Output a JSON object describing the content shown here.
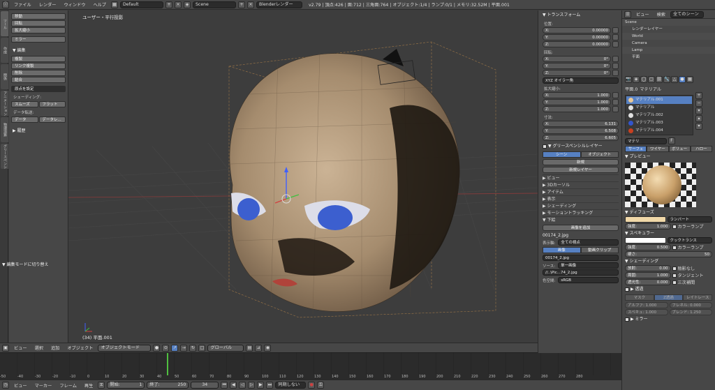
{
  "topbar": {
    "menus": [
      "ファイル",
      "レンダー",
      "ウィンドウ",
      "ヘルプ"
    ],
    "layout": "Default",
    "scene": "Scene",
    "engine": "Blenderレンダー",
    "stats": "v2.79 | 頂点:426 | 面:712 | 三角面:764 | オブジェクト:1/4 | ランプ:0/1 | メモリ:32.52M | 平面.001"
  },
  "lefttabs": [
    "ツール",
    "作成",
    "関係",
    "アニメーション",
    "物理演算",
    "グリースペンシル"
  ],
  "tools": {
    "transform_buttons": [
      "移動",
      "回転",
      "拡大縮小"
    ],
    "mirror": "ミラー",
    "edit_header": "▼ 編集",
    "edit_buttons": [
      "複製",
      "リンク複製",
      "削除",
      "結合"
    ],
    "origin_select": "原点を設定",
    "shading_label": "シェーディング:",
    "smooth": "スムーズ",
    "flat": "フラット",
    "data_transfer_label": "データ転送:",
    "data": "データ",
    "data_layout": "データレ...",
    "history": "▶ 履歴",
    "editmode_toggle": "▼ 編集モードに切り替え"
  },
  "viewport": {
    "label": "ユーザー・平行投影",
    "footer": "(34) 平面.001"
  },
  "header3d": {
    "menus": [
      "ビュー",
      "選択",
      "追加",
      "オブジェクト"
    ],
    "mode": "オブジェクトモード",
    "orientation": "グローバル"
  },
  "timeline": {
    "ticks": [
      "-50",
      "-40",
      "-30",
      "-20",
      "-10",
      "0",
      "10",
      "20",
      "30",
      "40",
      "50",
      "60",
      "70",
      "80",
      "90",
      "100",
      "110",
      "120",
      "130",
      "140",
      "150",
      "160",
      "170",
      "180",
      "190",
      "200",
      "210",
      "220",
      "230",
      "240",
      "250",
      "260",
      "270",
      "280"
    ],
    "current_frame": 34
  },
  "bottom": {
    "menus": [
      "ビュー",
      "マーカー",
      "フレーム",
      "再生"
    ],
    "start_label": "開始:",
    "start": "1",
    "end_label": "終了:",
    "end": "250",
    "current": "34",
    "sync": "同期しない"
  },
  "properties": {
    "transform_header": "▼ トランスフォーム",
    "location_label": "位置:",
    "location": [
      {
        "axis": "X:",
        "value": "0.00000"
      },
      {
        "axis": "Y:",
        "value": "0.00000"
      },
      {
        "axis": "Z:",
        "value": "0.00000"
      }
    ],
    "rotation_label": "回転:",
    "rotation": [
      {
        "axis": "X:",
        "value": "0°"
      },
      {
        "axis": "Y:",
        "value": "0°"
      },
      {
        "axis": "Z:",
        "value": "0°"
      }
    ],
    "euler": "XYZ オイラー角",
    "scale_label": "拡大縮小:",
    "scale": [
      {
        "axis": "X:",
        "value": "1.000"
      },
      {
        "axis": "Y:",
        "value": "1.000"
      },
      {
        "axis": "Z:",
        "value": "1.000"
      }
    ],
    "dims_label": "寸法:",
    "dims": [
      {
        "axis": "X:",
        "value": "6.131"
      },
      {
        "axis": "Y:",
        "value": "6.508"
      },
      {
        "axis": "Z:",
        "value": "6.605"
      }
    ],
    "grease_header": "▼ グリースペンシルレイヤー",
    "scene_tab": "シーン",
    "object_tab": "オブジェクト",
    "new": "新規",
    "new_layer": "新規レイヤー",
    "panels": [
      "▶ ビュー",
      "▶ 3Dカーソル",
      "▶ アイテム",
      "▶ 表示",
      "▶ シェーディング",
      "▶ モーショントラッキング",
      "▼ 下絵"
    ],
    "add_image": "画像を追加",
    "image_name": "00174_2.jpg",
    "axis_label": "表示軸:",
    "axis_value": "全ての視点",
    "image_tab": "画像",
    "movie_tab": "動画クリップ",
    "image_file": "00174_2.jpg",
    "source_label": "ソース:",
    "source_value": "単一画像",
    "path": "//..\\Pic...74_2.jpg",
    "colorspace_label": "色空間:",
    "colorspace_value": "sRGB"
  },
  "outliner": {
    "menus": [
      "ビュー",
      "検索"
    ],
    "filter": "全てのシーン",
    "rows": [
      "Scene",
      "レンダーレイヤー",
      "World",
      "Camera",
      "Lamp",
      "平面"
    ]
  },
  "material": {
    "object": "平面.0",
    "material": "マテリアル",
    "list": [
      "マテリアル.001",
      "マテリアル",
      "マテリアル.002",
      "マテリアル.003",
      "マテリアル.004"
    ],
    "list_colors": [
      "#e8c898",
      "#e0e0e0",
      "#e0e0e0",
      "#3355cc",
      "#c84020"
    ],
    "slot_name": "マテリ",
    "tabs": [
      "サーフェ",
      "ワイヤー",
      "ボリュー",
      "ハロー"
    ],
    "preview": "▼ プレビュー",
    "diffuse": "▼ ディフューズ",
    "lambert": "ランバート",
    "intensity_label": "強度:",
    "diffuse_intensity": "1.000",
    "ramp": "カラーランプ",
    "specular": "▼ スペキュラー",
    "cooktorr": "クックトランス",
    "spec_intensity": "0.500",
    "hardness_label": "硬さ:",
    "hardness": "50",
    "shading": "▼ シェーディング",
    "emit_label": "放射:",
    "emit": "0.00",
    "shadeless": "陰影なし",
    "ambient_label": "周囲:",
    "ambient": "1.000",
    "tangent": "タンジェント",
    "translucency_label": "透光性:",
    "translucency": "0.000",
    "cubic": "三次補間",
    "transparency": "▶ 透過",
    "trans_tabs": [
      "マスク",
      "Z透過",
      "レイトレース"
    ],
    "alpha": "アルファ: 1.000",
    "fresnel": "フレネル: 0.000",
    "specular2": "スペキュ: 1.000",
    "blend": "ブレンド: 1.250",
    "mirror": "▶ ミラー",
    "diffuse_color": "#f0d8a8"
  },
  "colors": {
    "accent": "#5680c2"
  }
}
